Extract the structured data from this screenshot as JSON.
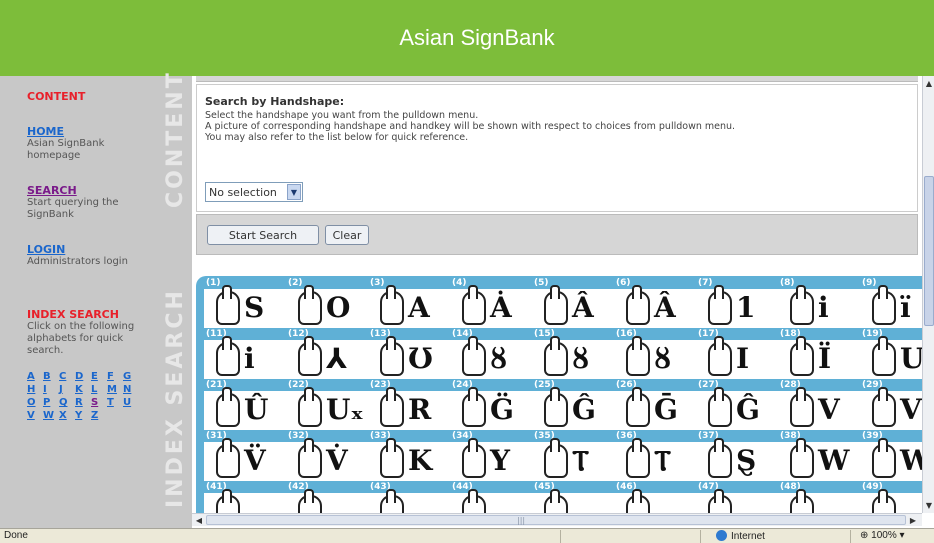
{
  "app": {
    "title": "Asian SignBank"
  },
  "sidebar": {
    "content_heading": "CONTENT",
    "vertical_labels": {
      "content": "CONTENT",
      "index_search": "INDEX SEARCH"
    },
    "items": [
      {
        "link": "HOME",
        "desc": "Asian SignBank homepage"
      },
      {
        "link": "SEARCH",
        "desc": "Start querying the SignBank"
      },
      {
        "link": "LOGIN",
        "desc": "Administrators login"
      }
    ],
    "index_heading": "INDEX SEARCH",
    "index_desc": "Click on the following alphabets for quick search.",
    "alphabet": [
      "A",
      "B",
      "C",
      "D",
      "E",
      "F",
      "G",
      "H",
      "I",
      "J",
      "K",
      "L",
      "M",
      "N",
      "O",
      "P",
      "Q",
      "R",
      "S",
      "T",
      "U",
      "V",
      "W",
      "X",
      "Y",
      "Z"
    ]
  },
  "search": {
    "title": "Search by Handshape:",
    "desc1": "Select the handshape you want from the pulldown menu.",
    "desc2": "A picture of corresponding handshape and handkey will be shown with respect to choices from pulldown menu.",
    "desc3": "You may also refer to the list below for quick reference.",
    "select_value": "No selection",
    "start_button": "Start Search",
    "clear_button": "Clear"
  },
  "handshapes": {
    "rows": [
      {
        "nums": [
          "(1)",
          "(2)",
          "(3)",
          "(4)",
          "(5)",
          "(6)",
          "(7)",
          "(8)",
          "(9)"
        ],
        "keys": [
          "S",
          "O",
          "A",
          "Ȧ",
          "Â",
          "Â",
          "1",
          "i",
          "ï"
        ]
      },
      {
        "nums": [
          "(11)",
          "(12)",
          "(13)",
          "(14)",
          "(15)",
          "(16)",
          "(17)",
          "(18)",
          "(19)"
        ],
        "keys": [
          "i",
          "⅄",
          "Ʊ",
          "ȣ",
          "ȣ",
          "ȣ",
          "I",
          "Ï",
          "U"
        ]
      },
      {
        "nums": [
          "(21)",
          "(22)",
          "(23)",
          "(24)",
          "(25)",
          "(26)",
          "(27)",
          "(28)",
          "(29)"
        ],
        "keys": [
          "Û",
          "Uₓ",
          "R",
          "G̈",
          "Ĝ",
          "Ḡ",
          "Ĝ",
          "V",
          "V"
        ]
      },
      {
        "nums": [
          "(31)",
          "(32)",
          "(33)",
          "(34)",
          "(35)",
          "(36)",
          "(37)",
          "(38)",
          "(39)"
        ],
        "keys": [
          "V̈",
          "V̇",
          "K",
          "Y",
          "Ⲧ",
          "Ⲧ",
          "Ȿ",
          "W",
          "W"
        ]
      },
      {
        "nums": [
          "(41)",
          "(42)",
          "(43)",
          "(44)",
          "(45)",
          "(46)",
          "(47)",
          "(48)",
          "(49)"
        ],
        "keys": [
          "",
          "",
          "",
          "",
          "",
          "",
          "",
          "",
          ""
        ]
      }
    ]
  },
  "status": {
    "left": "Done",
    "zone": "Internet",
    "zoom": "100%"
  }
}
